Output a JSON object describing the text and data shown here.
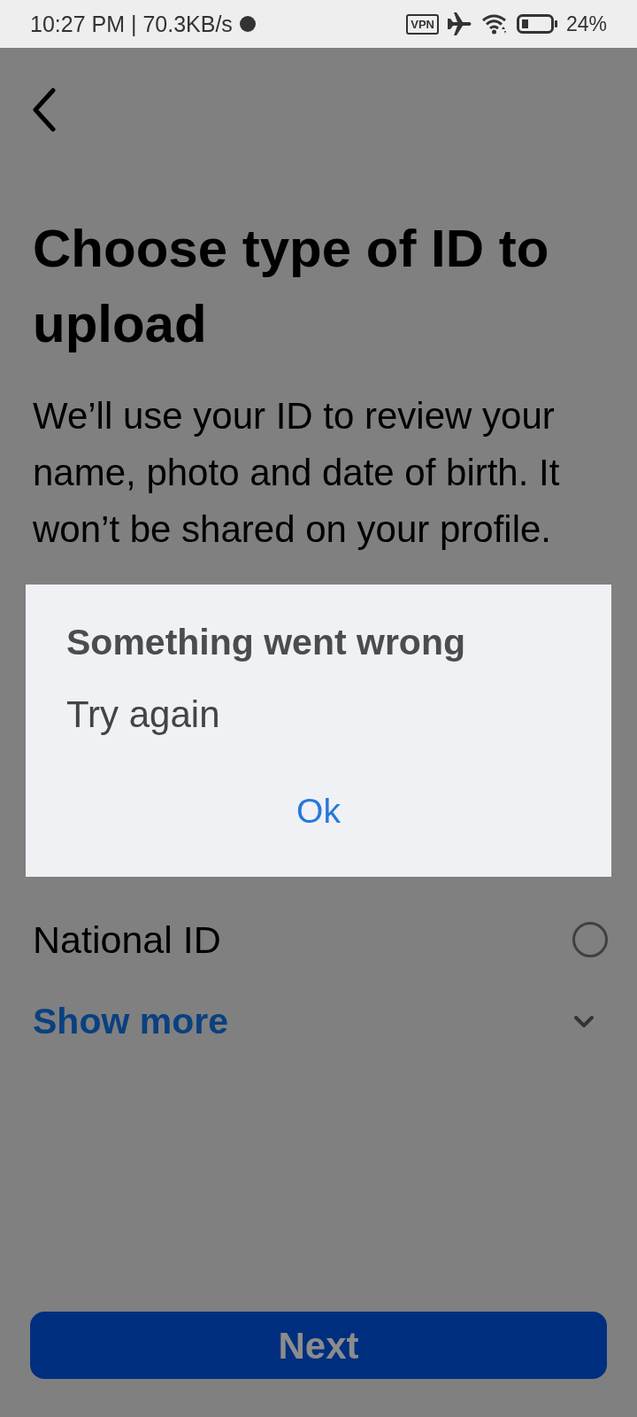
{
  "status_bar": {
    "time_speed": "10:27 PM | 70.3KB/s",
    "vpn": "VPN",
    "battery": "24%"
  },
  "title": "Choose type of ID to upload",
  "description": "We’ll use your ID to review your name, photo and date of birth. It won’t be shared on your profile.",
  "dialog": {
    "title": "Something went wrong",
    "message": "Try again",
    "button": "Ok"
  },
  "id_options": [
    {
      "label": "National ID",
      "selected": false
    }
  ],
  "show_more": {
    "label": "Show more",
    "expanded": false
  },
  "next_button": {
    "label": "Next",
    "disabled": true
  }
}
